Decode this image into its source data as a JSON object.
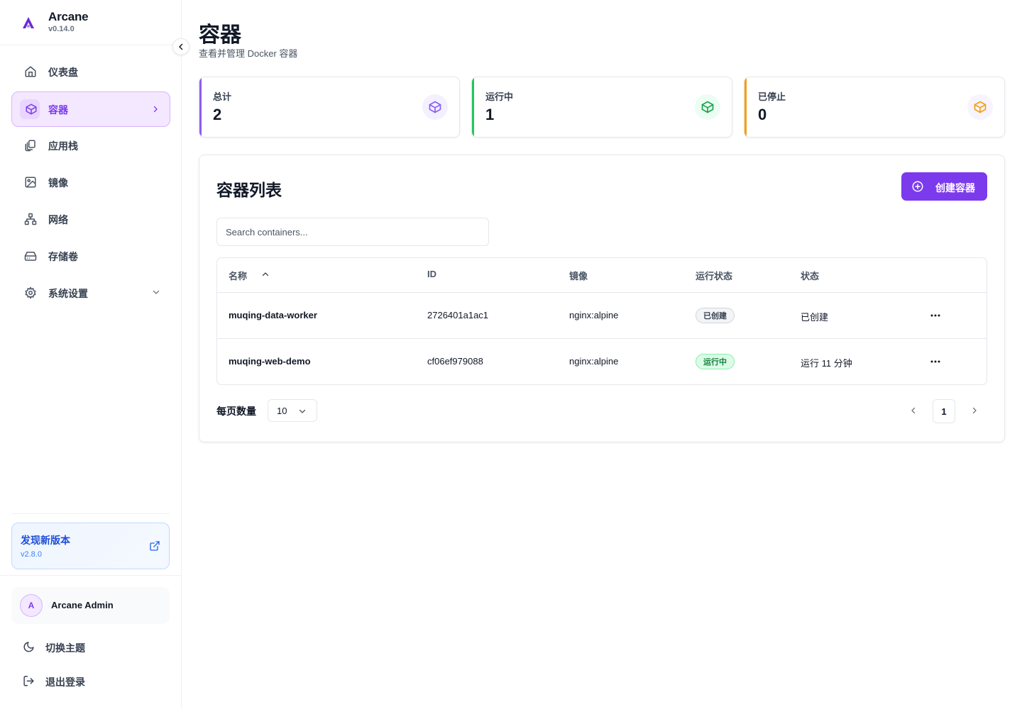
{
  "app": {
    "name": "Arcane",
    "version": "v0.14.0",
    "accent_color": "#7c3aed"
  },
  "sidebar": {
    "items": [
      {
        "label": "仪表盘",
        "icon": "home-icon"
      },
      {
        "label": "容器",
        "icon": "box-icon",
        "active": true
      },
      {
        "label": "应用栈",
        "icon": "layers-icon"
      },
      {
        "label": "镜像",
        "icon": "image-icon"
      },
      {
        "label": "网络",
        "icon": "network-icon"
      },
      {
        "label": "存储卷",
        "icon": "hard-drive-icon"
      },
      {
        "label": "系统设置",
        "icon": "gear-icon"
      }
    ],
    "update": {
      "title": "发现新版本",
      "version": "v2.8.0"
    },
    "user": {
      "initial": "A",
      "name": "Arcane Admin"
    },
    "footer": {
      "theme_label": "切换主题",
      "logout_label": "退出登录"
    }
  },
  "page": {
    "title": "容器",
    "subtitle": "查看并管理 Docker 容器"
  },
  "stats": [
    {
      "label": "总计",
      "value": "2",
      "color": "#8b5cf6"
    },
    {
      "label": "运行中",
      "value": "1",
      "color": "#22c55e"
    },
    {
      "label": "已停止",
      "value": "0",
      "color": "#f59e0b"
    }
  ],
  "list": {
    "title": "容器列表",
    "create_label": "创建容器",
    "search_placeholder": "Search containers...",
    "columns": [
      "名称",
      "ID",
      "镜像",
      "运行状态",
      "状态"
    ],
    "rows": [
      {
        "name": "muqing-data-worker",
        "id": "2726401a1ac1",
        "image": "nginx:alpine",
        "state": "已创建",
        "status": "已创建"
      },
      {
        "name": "muqing-web-demo",
        "id": "cf06ef979088",
        "image": "nginx:alpine",
        "state": "运行中",
        "status": "运行 11 分钟"
      }
    ],
    "page_size_label": "每页数量",
    "page_size": "10",
    "current_page": "1"
  }
}
